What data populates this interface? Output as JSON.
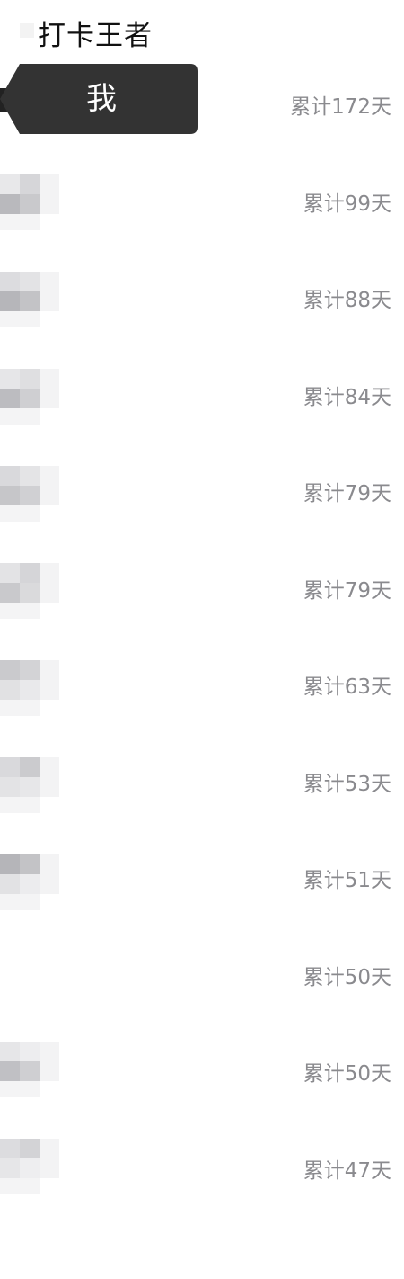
{
  "page_title": "打卡王者",
  "me_label": "我",
  "rows": [
    {
      "days": "累计172天"
    },
    {
      "days": "累计99天"
    },
    {
      "days": "累计88天"
    },
    {
      "days": "累计84天"
    },
    {
      "days": "累计79天"
    },
    {
      "days": "累计79天"
    },
    {
      "days": "累计63天"
    },
    {
      "days": "累计53天"
    },
    {
      "days": "累计51天"
    },
    {
      "days": "累计50天"
    },
    {
      "days": "累计50天"
    },
    {
      "days": "累计47天"
    }
  ],
  "colors": {
    "me_tag_background": "#333333",
    "days_text": "#8a8a8e"
  }
}
